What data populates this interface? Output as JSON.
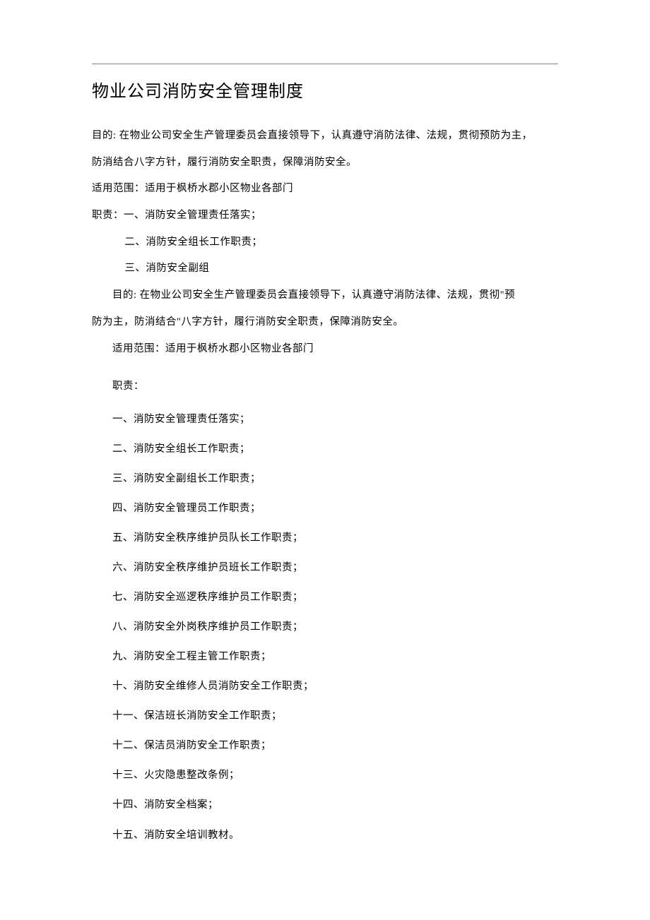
{
  "title": "物业公司消防安全管理制度",
  "intro": {
    "p1": "目的: 在物业公司安全生产管理委员会直接领导下，认真遵守消防法律、法规，贯彻预防为主，",
    "p2": "防消结合八字方针，履行消防安全职责，保障消防安全。",
    "scope": "适用范围：适用于枫桥水郡小区物业各部门",
    "dutyLabel": "职责：一、消防安全管理责任落实；",
    "duty2": "二、消防安全组长工作职责；",
    "duty3": "三、消防安全副组"
  },
  "body": {
    "aim1": "目的: 在物业公司安全生产管理委员会直接领导下，认真遵守消防法律、法规，贯彻\"预",
    "aim2": "防为主，防消结合\"八字方针，履行消防安全职责，保障消防安全。",
    "scope": "适用范围：适用于枫桥水郡小区物业各部门",
    "dutyLabel": "职责："
  },
  "items": [
    "一、消防安全管理责任落实；",
    "二、消防安全组长工作职责；",
    "三、消防安全副组长工作职责；",
    "四、消防安全管理员工作职责；",
    "五、消防安全秩序维护员队长工作职责；",
    "六、消防安全秩序维护员班长工作职责；",
    "七、消防安全巡逻秩序维护员工作职责；",
    "八、消防安全外岗秩序维护员工作职责；",
    "九、消防安全工程主管工作职责；",
    "十、消防安全维修人员消防安全工作职责；",
    "十一、保洁班长消防安全工作职责；",
    "十二、保洁员消防安全工作职责；",
    "十三、火灾隐患整改条例；",
    "十四、消防安全档案；",
    "十五、消防安全培训教材。"
  ]
}
